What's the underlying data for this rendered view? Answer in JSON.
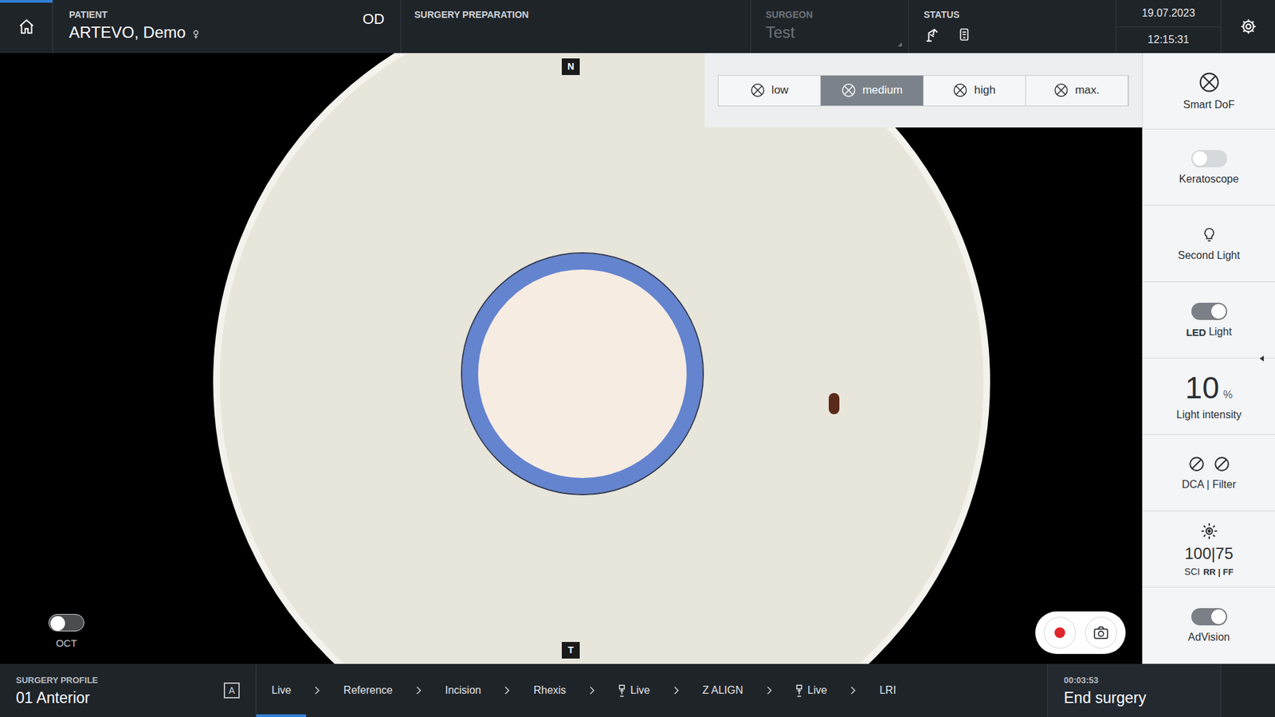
{
  "header": {
    "patient_label": "PATIENT",
    "patient_name": "ARTEVO, Demo",
    "eye": "OD",
    "phase": "SURGERY PREPARATION",
    "surgeon_label": "SURGEON",
    "surgeon": "Test",
    "surgeon_disabled": true,
    "status_label": "STATUS",
    "date": "19.07.2023",
    "time": "12:15:31"
  },
  "video": {
    "north": "N",
    "temporal": "T"
  },
  "oct": {
    "label": "OCT",
    "on": false
  },
  "smart_dof": {
    "options": [
      {
        "label": "low",
        "selected": false
      },
      {
        "label": "medium",
        "selected": true
      },
      {
        "label": "high",
        "selected": false
      },
      {
        "label": "max.",
        "selected": false
      }
    ]
  },
  "side_panel": {
    "items": [
      {
        "kind": "dof",
        "label": "Smart DoF"
      },
      {
        "kind": "toggle",
        "label": "Keratoscope",
        "on": false
      },
      {
        "kind": "lamp",
        "label": "Second Light"
      },
      {
        "kind": "toggle",
        "prefix": "LED",
        "label": "Light",
        "on": true
      },
      {
        "kind": "value",
        "value": "10",
        "unit": "%",
        "label": "Light intensity"
      },
      {
        "kind": "filter",
        "label": "DCA | Filter"
      },
      {
        "kind": "sci",
        "value": "100|75",
        "label": "SCI",
        "suffix": "RR | FF"
      },
      {
        "kind": "toggle",
        "label": "AdVision",
        "on": true
      }
    ]
  },
  "footer": {
    "profile_label": "SURGERY PROFILE",
    "profile": "01 Anterior",
    "profile_badge": "A",
    "steps": [
      {
        "label": "Live",
        "selected": true,
        "kind": "plain"
      },
      {
        "label": "Reference",
        "selected": false,
        "kind": "plain"
      },
      {
        "label": "Incision",
        "selected": false,
        "kind": "plain"
      },
      {
        "label": "Rhexis",
        "selected": false,
        "kind": "plain"
      },
      {
        "label": "Live",
        "selected": false,
        "kind": "device"
      },
      {
        "label": "Z ALIGN",
        "selected": false,
        "kind": "plain"
      },
      {
        "label": "Live",
        "selected": false,
        "kind": "device"
      },
      {
        "label": "LRI",
        "selected": false,
        "kind": "plain"
      }
    ],
    "elapsed": "00:03:53",
    "end": "End surgery"
  }
}
